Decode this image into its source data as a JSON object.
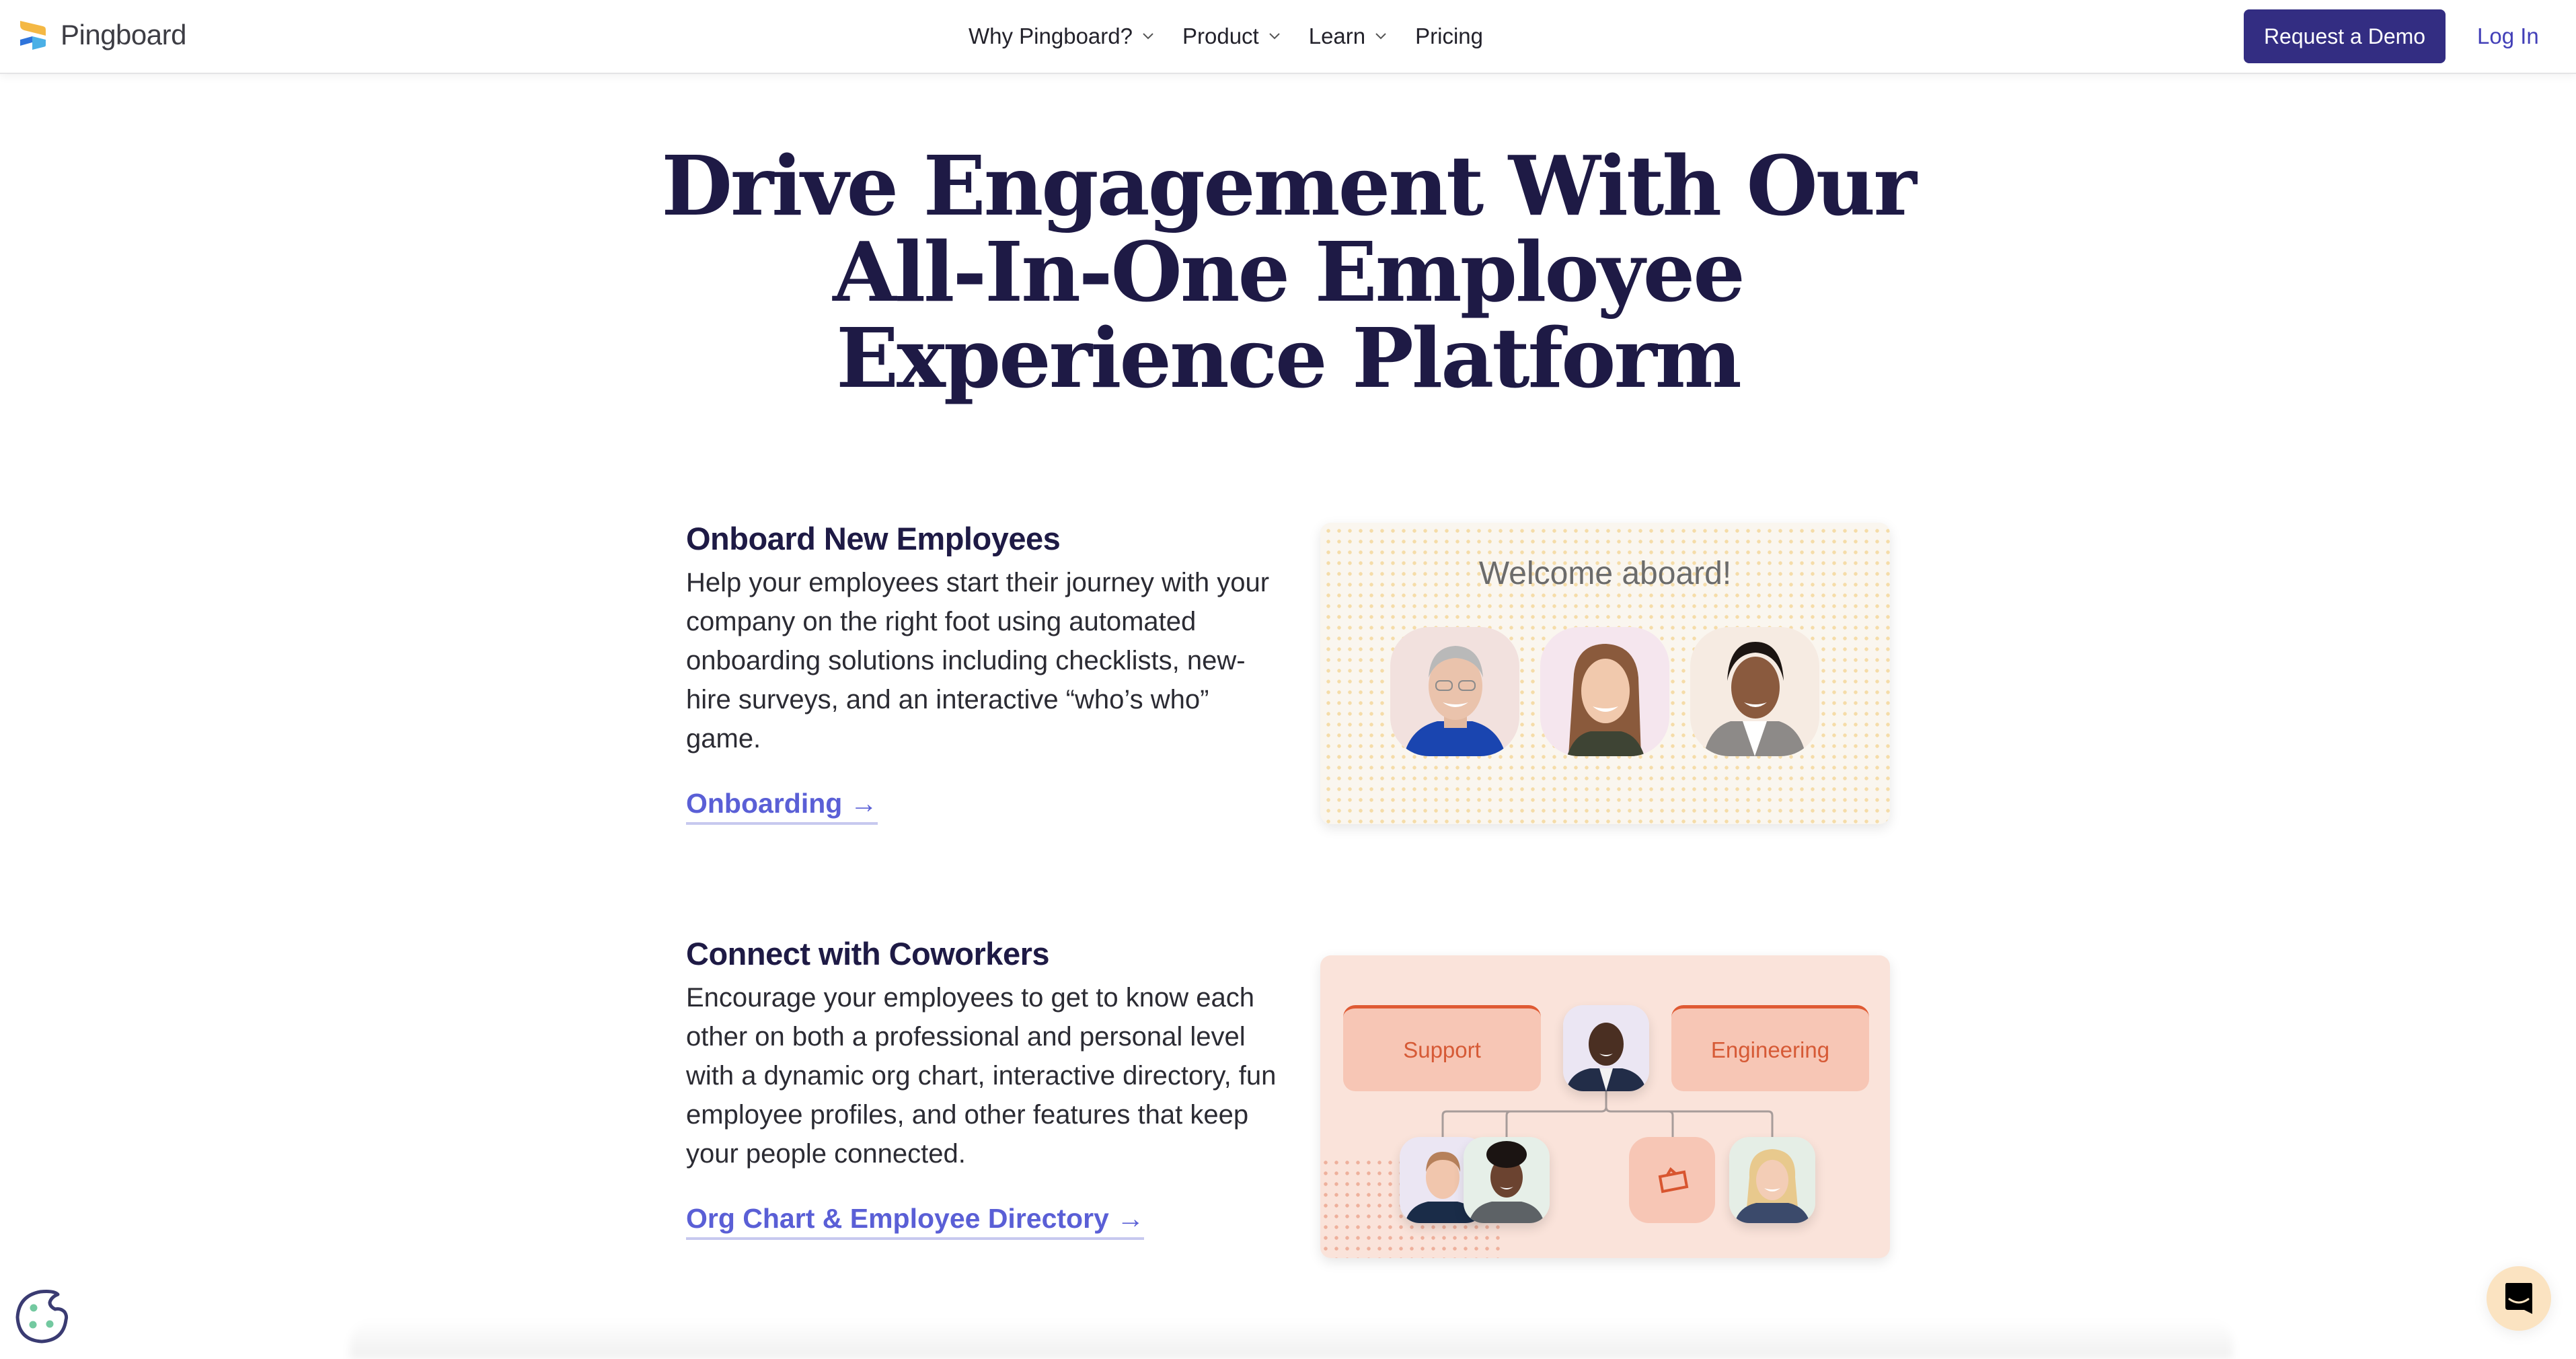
{
  "nav": {
    "brand": "Pingboard",
    "logo_icon": "pingboard-logo-icon",
    "links": [
      {
        "label": "Why Pingboard?",
        "has_dropdown": true
      },
      {
        "label": "Product",
        "has_dropdown": true
      },
      {
        "label": "Learn",
        "has_dropdown": true
      },
      {
        "label": "Pricing",
        "has_dropdown": false
      }
    ],
    "cta_label": "Request a Demo",
    "login_label": "Log In"
  },
  "hero": {
    "lines": [
      "Drive Engagement With Our",
      "All-In-One Employee",
      "Experience Platform"
    ]
  },
  "features": [
    {
      "title": "Onboard New Employees",
      "body": "Help your employees start their journey with your company on the right foot using automated onboarding solutions including checklists, new-hire surveys, and an interactive “who’s who” game.",
      "link_label": "Onboarding →",
      "card": {
        "heading": "Welcome aboard!",
        "avatars": [
          "new-hire-photo-1",
          "new-hire-photo-2",
          "new-hire-photo-3"
        ]
      }
    },
    {
      "title": "Connect with Coworkers",
      "body": "Encourage your employees to get to know each other on both a professional and personal level with a dynamic org chart, interactive directory, fun employee profiles, and other features that keep your people connected.",
      "link_label": "Org Chart & Employee Directory →",
      "card": {
        "departments": [
          "Support",
          "Engineering"
        ],
        "manager_avatar": "manager-photo",
        "reports": [
          "report-photo-1",
          "report-photo-2",
          "frame-icon",
          "report-photo-3"
        ]
      }
    }
  ],
  "colors": {
    "brand_navy": "#1e1a45",
    "cta_bg": "#332d82",
    "link": "#5a5fd6",
    "accent_orange": "#df5a33"
  },
  "widgets": {
    "cookie_icon": "cookie-icon",
    "chat_icon": "chat-icon"
  }
}
